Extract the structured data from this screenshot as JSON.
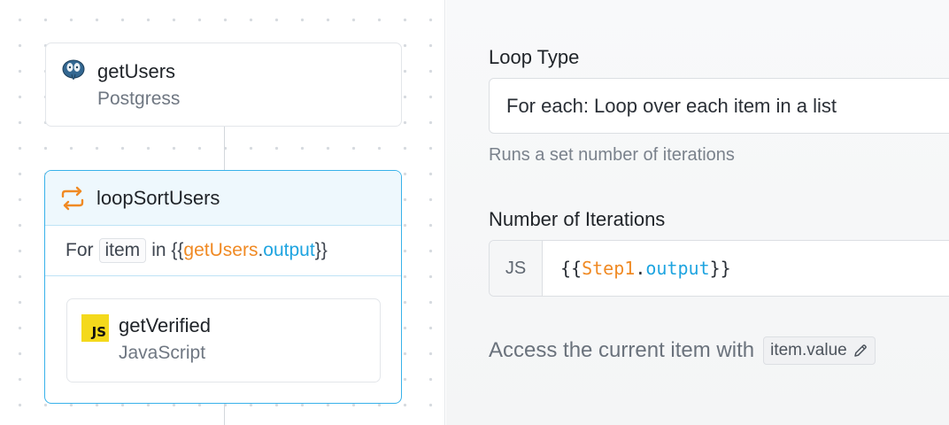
{
  "canvas": {
    "nodes": [
      {
        "title": "getUsers",
        "subtitle": "Postgress",
        "icon": "postgres-elephant-icon"
      },
      {
        "title": "getVerified",
        "subtitle": "JavaScript",
        "icon": "javascript-icon",
        "icon_text": "JS"
      }
    ],
    "loop": {
      "title": "loopSortUsers",
      "icon": "loop-arrows-icon",
      "for_word": "For",
      "item_var": "item",
      "in_word": "in",
      "open_brace": "{{",
      "source_step": "getUsers",
      "dot": ".",
      "source_prop": "output",
      "close_brace": "}}"
    }
  },
  "panel": {
    "loop_type_label": "Loop Type",
    "loop_type_value": "For each: Loop over each item in a list",
    "helper_text": "Runs a set number of iterations",
    "iterations_label": "Number of Iterations",
    "iterations_prefix": "JS",
    "code": {
      "open": "{{",
      "step": "Step1",
      "dot": ".",
      "prop": "output",
      "close": "}}"
    },
    "access_text": "Access the current item with",
    "item_value_chip": "item.value"
  },
  "colors": {
    "accent_blue": "#38b2ea",
    "code_orange": "#f08a24",
    "code_blue": "#1ea4e0",
    "js_yellow": "#f4d91c"
  }
}
